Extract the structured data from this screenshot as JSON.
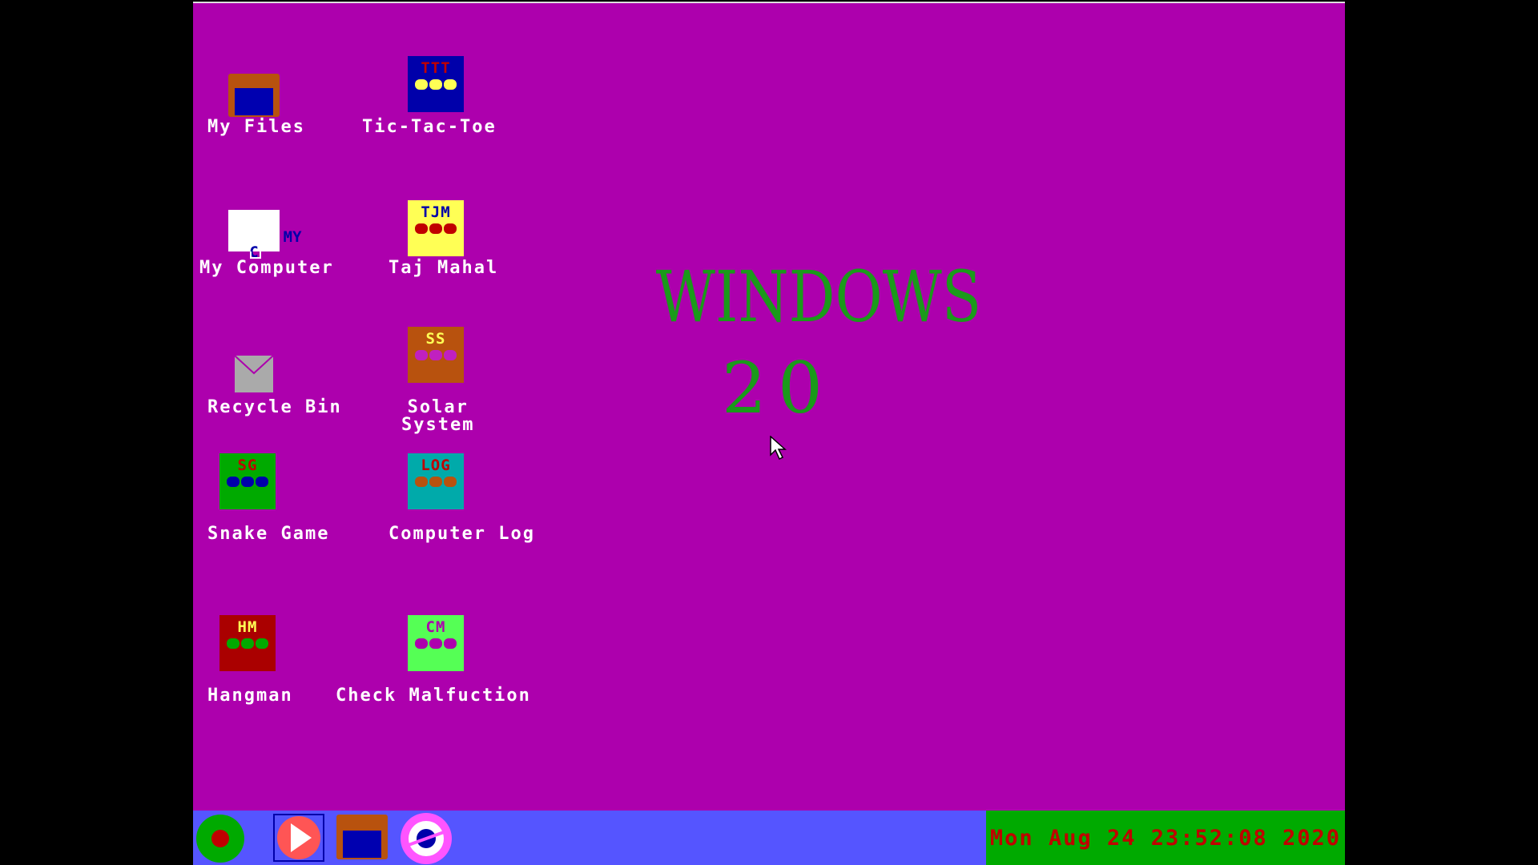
{
  "desktop": {
    "logo": {
      "title": "WINDOWS",
      "version": "20"
    },
    "icons": [
      {
        "label": "My Files"
      },
      {
        "label": "Tic-Tac-Toe",
        "badge": "TTT"
      },
      {
        "label": "My Computer",
        "badge": "MY\nC"
      },
      {
        "label": "Taj Mahal",
        "badge": "TJM"
      },
      {
        "label": "Recycle Bin"
      },
      {
        "label": "Solar\nSystem",
        "badge": "SS"
      },
      {
        "label": "Snake Game",
        "badge": "SG"
      },
      {
        "label": "Computer Log",
        "badge": "LOG"
      },
      {
        "label": "Hangman",
        "badge": "HM"
      },
      {
        "label": "Check Malfuction",
        "badge": "CM"
      }
    ]
  },
  "taskbar": {
    "items": [
      "start-button",
      "media-player",
      "file-explorer",
      "browser"
    ],
    "clock": "Mon Aug 24 23:52:08 2020"
  },
  "colors": {
    "desktop_bg": "#ad00ad",
    "taskbar_bg": "#5555ff",
    "clock_bg": "#00aa00",
    "clock_text": "#c00000",
    "logo_text": "#1a9a1a"
  }
}
